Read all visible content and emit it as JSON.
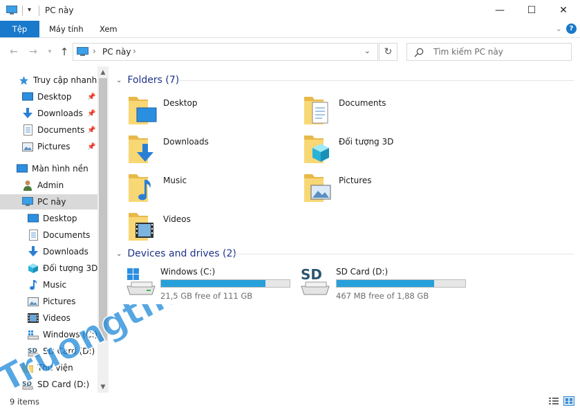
{
  "window": {
    "title": "PC này",
    "minimize": "—",
    "maximize": "☐",
    "close": "✕"
  },
  "ribbon": {
    "tabs": [
      {
        "label": "Tệp",
        "active": true
      },
      {
        "label": "Máy tính",
        "active": false
      },
      {
        "label": "Xem",
        "active": false
      }
    ],
    "help": "?"
  },
  "address": {
    "path": "PC này",
    "search_placeholder": "Tìm kiếm PC này"
  },
  "sidebar": {
    "quick_access": "Truy cập nhanh",
    "quick_items": [
      "Desktop",
      "Downloads",
      "Documents",
      "Pictures"
    ],
    "desktop_root": "Màn hình nền",
    "admin": "Admin",
    "this_pc": "PC này",
    "pc_items": [
      "Desktop",
      "Documents",
      "Downloads",
      "Đối tượng 3D",
      "Music",
      "Pictures",
      "Videos",
      "Windows (C:)",
      "SD Card (D:)"
    ],
    "libraries": "Thư viện",
    "sd_card": "SD Card (D:)"
  },
  "main": {
    "folders_header": "Folders (7)",
    "folders": [
      "Desktop",
      "Documents",
      "Downloads",
      "Đối tượng 3D",
      "Music",
      "Pictures",
      "Videos"
    ],
    "drives_header": "Devices and drives (2)",
    "drives": [
      {
        "name": "Windows (C:)",
        "free": "21,5 GB free of 111 GB",
        "used_fraction": 0.81
      },
      {
        "name": "SD Card (D:)",
        "free": "467 MB free of 1,88 GB",
        "used_fraction": 0.76
      }
    ],
    "sd_label": "SD"
  },
  "status": {
    "items": "9 items"
  },
  "watermark": "Truongtin.top",
  "colors": {
    "accent": "#1979ca",
    "drive_bar": "#26a0da",
    "group_header": "#1e3287",
    "folder_yellow": "#f8d775"
  }
}
